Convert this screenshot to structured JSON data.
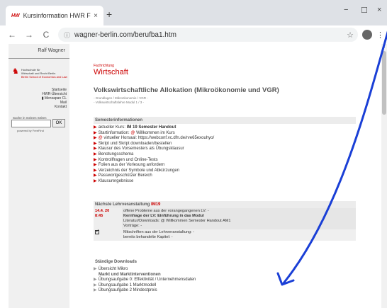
{
  "browser": {
    "tab_favicon": "HW",
    "tab_title": "Kursinformation HWR FB 2",
    "tab_close": "×",
    "new_tab": "+",
    "win_min": "−",
    "win_max": "☐",
    "win_close": "×",
    "back": "←",
    "forward": "→",
    "reload": "C",
    "url": "wagner-berlin.com/berufba1.htm",
    "lock_icon": "ⓘ",
    "star_icon": "☆",
    "menu_icon": "⋮"
  },
  "sidebar": {
    "author": "Ralf Wagner",
    "logo_icon": "bear-icon",
    "logo_lines": [
      "Hochschule für",
      "Wirtschaft und Recht Berlin",
      "Berlin School of Economics and Law"
    ],
    "nav": [
      "Startseite",
      "HWR-Übersicht",
      "Mensapan CL",
      "Mail",
      "Kontakt"
    ],
    "search_label": "Suche in meinen Seiten",
    "search_button": "OK",
    "powered_by": "powered by FreeFind"
  },
  "main": {
    "fachrichtung_label": "Fachrichtung",
    "fachrichtung": "Wirtschaft",
    "course_title": "Volkswirtschaftliche Allokation (Mikroökonomie und VGR)",
    "course_sub": [
      "- Grundlagen / Mikroökonomie / VGR -",
      "- Volkswirtschaftslehre Modul 1 / 3 -"
    ],
    "semester_header": "Semesterinformationen",
    "semester_items": [
      {
        "pre": "aktueller Kurs: ",
        "bold": "IM 19 Semester Handout",
        "red": "",
        "rest": ""
      },
      {
        "pre": "Startinformation: ",
        "bold": "",
        "red": "@",
        "rest": " Willkommen im Kurs"
      },
      {
        "pre": "",
        "bold": "",
        "red": "@",
        "rest": " virtueller Horsaal: https://webconf.vc.dfn.de/rve65exouhyo/"
      },
      {
        "pre": "Skript und Skript downloaden/bestellen",
        "bold": "",
        "red": "",
        "rest": ""
      },
      {
        "pre": "Klausur des Vorsemesters als Übungsklausur",
        "bold": "",
        "red": "",
        "rest": ""
      },
      {
        "pre": "Benotungsschema",
        "bold": "",
        "red": "",
        "rest": ""
      },
      {
        "pre": "Kontrollfragen und Online-Tests",
        "bold": "",
        "red": "",
        "rest": ""
      },
      {
        "pre": "Folien aus der Vorlesung anfordern",
        "bold": "",
        "red": "",
        "rest": ""
      },
      {
        "pre": "Verzeichnis der Symbole und Abkürzungen",
        "bold": "",
        "red": "",
        "rest": ""
      },
      {
        "pre": "Passwortgeschützer Bereich",
        "bold": "",
        "red": "",
        "rest": ""
      },
      {
        "pre": "Klausurergebnisse",
        "bold": "",
        "red": "",
        "rest": ""
      }
    ],
    "next_header": "Nächste Lehrveranstaltung",
    "next_header_code": "IM19",
    "lv_date": "14.4. 20",
    "lv_time": "8:45",
    "lv_lines": [
      "offene Probleme aus der vorangegangenen LV: -",
      "Kernfrage der LV: Einführung in das Modul",
      "Literatur/Downloads: @ Willkommen Semester Handout AM1",
      "Vorträge: -"
    ],
    "lv2_lines": [
      "Mitschriften aus der Lehrveranstaltung: -",
      "bereits behandelte Kapitel: -"
    ],
    "downloads_header": "Ständige Downloads",
    "downloads_items": [
      "Übersicht Mikro",
      "Markt und Marktinterventionen",
      "Übungsaufgabe 0: Effektivität / Unternehmensdaten",
      "Übungsaufgabe 1 Marktmodell",
      "Übungsaufgabe 2 Mindestpreis"
    ]
  },
  "annotation": {
    "color": "#1a3fd6",
    "icon": "arrow-icon"
  }
}
